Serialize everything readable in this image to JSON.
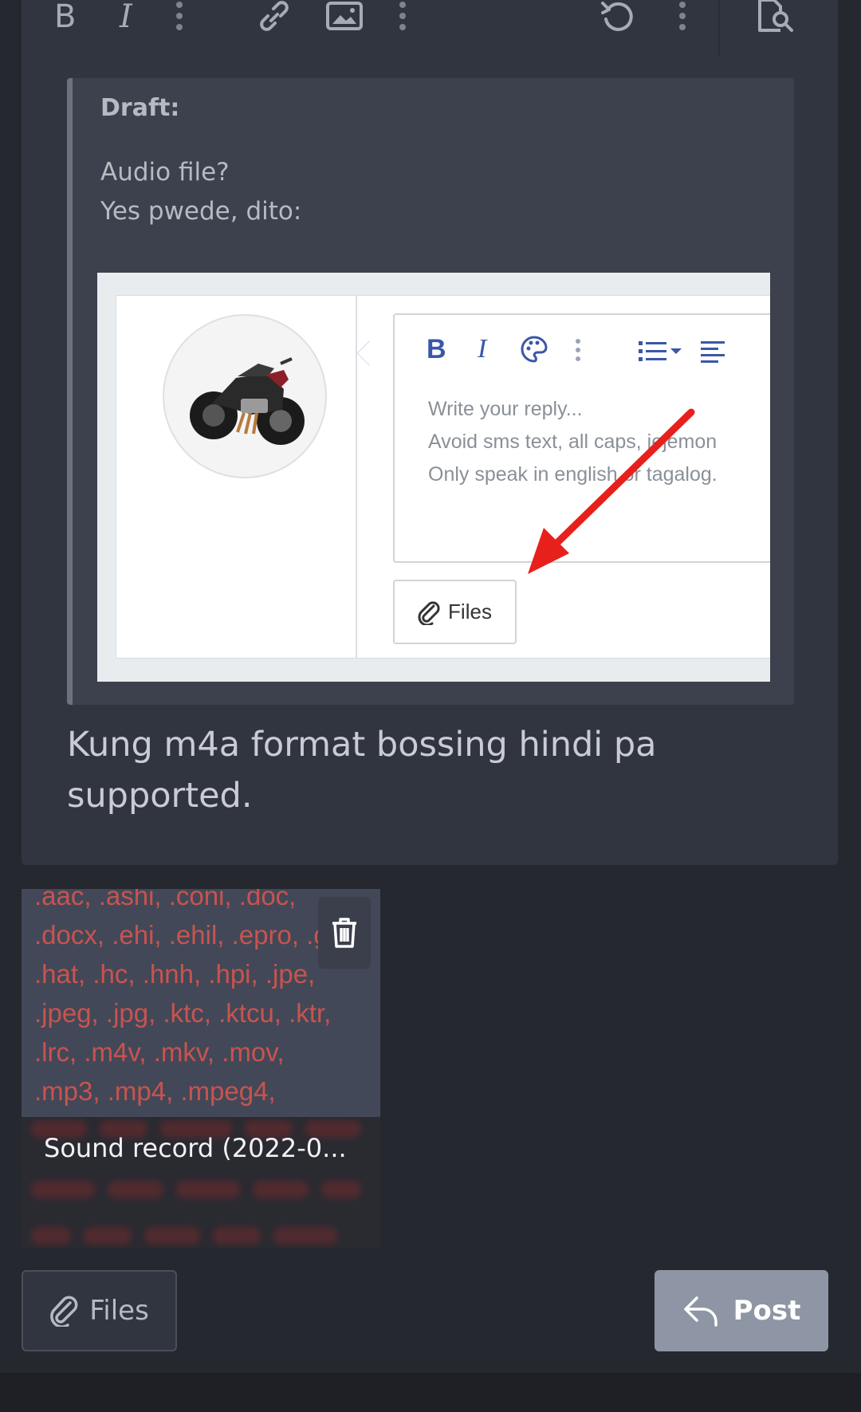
{
  "toolbar": {
    "icons": [
      "bold-icon",
      "italic-icon",
      "more-options-icon",
      "link-icon",
      "image-icon",
      "more-options-icon",
      "undo-icon",
      "more-options-icon",
      "preview-icon"
    ]
  },
  "draft": {
    "label": "Draft:",
    "lines": [
      "Audio file?",
      "Yes pwede, dito:"
    ]
  },
  "embedded_screenshot": {
    "placeholder_lines": [
      "Write your reply...",
      "Avoid sms text, all caps, jejemon",
      "Only speak in english or tagalog."
    ],
    "files_label": "Files",
    "arrow_color": "#e8201c"
  },
  "message": {
    "lines": [
      "Kung m4a format bossing hindi pa",
      "supported."
    ]
  },
  "attachment": {
    "lines": [
      ".aac, .ashi, .coni, .doc,",
      ".docx, .ehi, .ehil, .epro, .g",
      ".hat, .hc, .hnh, .hpi, .jpe,",
      ".jpeg, .jpg, .ktc, .ktcu, .ktr,",
      ".lrc, .m4v, .mkv, .mov,",
      ".mp3, .mp4, .mpeg4,"
    ],
    "name": "Sound record (2022-0..."
  },
  "actions": {
    "files_label": "Files",
    "post_label": "Post"
  },
  "colors": {
    "background": "#262830",
    "panel": "#313540",
    "error_text": "#c9534f",
    "post_button": "#8e96a5"
  }
}
